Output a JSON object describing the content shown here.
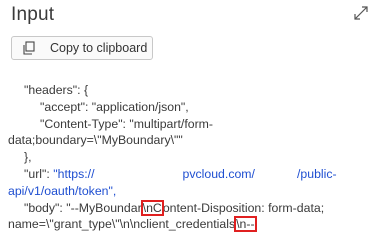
{
  "panel": {
    "title": "Input",
    "copy_label": "Copy to clipboard"
  },
  "icons": {
    "expand": "expand-diagonal-arrows",
    "copy": "copy-clipboard"
  },
  "code_lines": {
    "l1": "\"headers\": {",
    "l2": "\"accept\": \"application/json\",",
    "l3": "\"Content-Type\": \"multipart/form-",
    "l4": "data;boundary=\\\"MyBoundary\\\"\"",
    "l5": "},",
    "l6_key": "\"url\": ",
    "l6_a": "\"https://",
    "l6_b": "pvcloud.com/",
    "l6_c": "/public-",
    "l7": "api/v1/oauth/token\",",
    "l8_a": "\"body\": \"--MyBoundar",
    "l8_hl": "\\nC",
    "l8_b": "ontent-Disposition: form-data;",
    "l9_a": "name=\\\"grant_type\\\"\\n\\nclient_credentials",
    "l9_hl": "\\n--"
  },
  "colors": {
    "url_text": "#1f4fd1",
    "highlight_box": "#e02020"
  }
}
